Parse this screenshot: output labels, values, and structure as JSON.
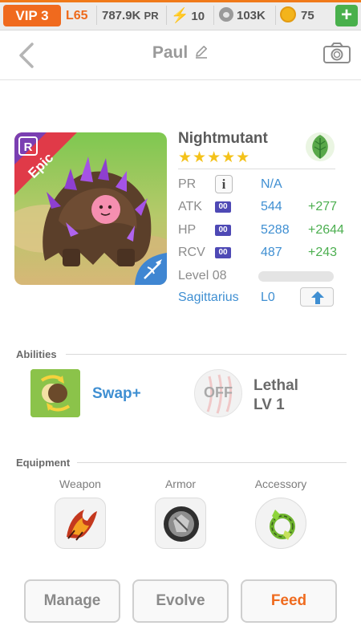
{
  "status_bar": {
    "vip_label": "VIP 3",
    "level_label": "L65",
    "power_value": "787.9K",
    "power_suffix": "PR",
    "energy_value": "10",
    "paw_value": "103K",
    "coin_value": "75",
    "add_label": "+"
  },
  "header": {
    "title": "Paul"
  },
  "monster": {
    "name": "Nightmutant",
    "rarity": "Epic",
    "rank_badge": "R",
    "stars": "★★★★★",
    "element_icon": "leaf-icon",
    "stats": {
      "pr_label": "PR",
      "pr_info": "i",
      "pr_value": "N/A",
      "atk_label": "ATK",
      "atk_badge": "00",
      "atk_value": "544",
      "atk_bonus": "+277",
      "hp_label": "HP",
      "hp_badge": "00",
      "hp_value": "5288",
      "hp_bonus": "+2644",
      "rcv_label": "RCV",
      "rcv_badge": "00",
      "rcv_value": "487",
      "rcv_bonus": "+243",
      "level_label": "Level 08",
      "level_progress": 0.0
    },
    "constellation": "Sagittarius",
    "constellation_level": "L0"
  },
  "abilities": {
    "title": "Abilities",
    "items": [
      {
        "name": "Swap+"
      },
      {
        "state": "OFF",
        "name": "Lethal",
        "level": "LV 1"
      }
    ]
  },
  "equipment": {
    "title": "Equipment",
    "slots": [
      {
        "label": "Weapon"
      },
      {
        "label": "Armor"
      },
      {
        "label": "Accessory"
      }
    ]
  },
  "actions": {
    "manage": "Manage",
    "evolve": "Evolve",
    "feed": "Feed"
  },
  "colors": {
    "accent_orange": "#f06a1e",
    "link_blue": "#3f8fd2",
    "bonus_green": "#4caf50",
    "stat_badge": "#4e49b5"
  }
}
